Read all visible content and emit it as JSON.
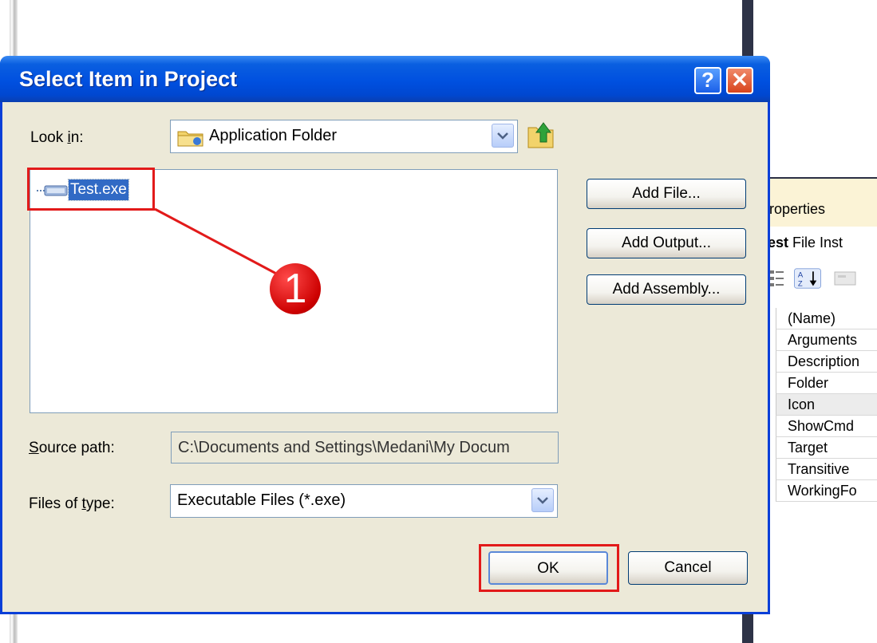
{
  "dialog": {
    "title": "Select Item in Project",
    "help_glyph": "?",
    "close_glyph": "✕",
    "look_in_label": "Look in:",
    "look_in_value": "Application Folder",
    "files": [
      {
        "name": "Test.exe",
        "icon": "exe-file-icon",
        "selected": true
      }
    ],
    "buttons": {
      "add_file": "Add File...",
      "add_output": "Add Output...",
      "add_assembly": "Add Assembly..."
    },
    "source_path_label": "Source path:",
    "source_path_value": "C:\\Documents and Settings\\Medani\\My Docum",
    "files_of_type_label": "Files of type:",
    "files_of_type_value": "Executable Files (*.exe)",
    "ok": "OK",
    "cancel": "Cancel"
  },
  "annotation": {
    "step_number": "1",
    "color": "#e21a1a"
  },
  "properties_panel": {
    "title": "roperties",
    "subtitle_bold": "est",
    "subtitle_rest": "File Inst",
    "rows": [
      "(Name)",
      "Arguments",
      "Description",
      "Folder",
      "Icon",
      "ShowCmd",
      "Target",
      "Transitive",
      "WorkingFo"
    ]
  },
  "colors": {
    "titlebar": "#0050e0",
    "dialog_bg": "#ece9d8",
    "selection": "#316ac5"
  }
}
